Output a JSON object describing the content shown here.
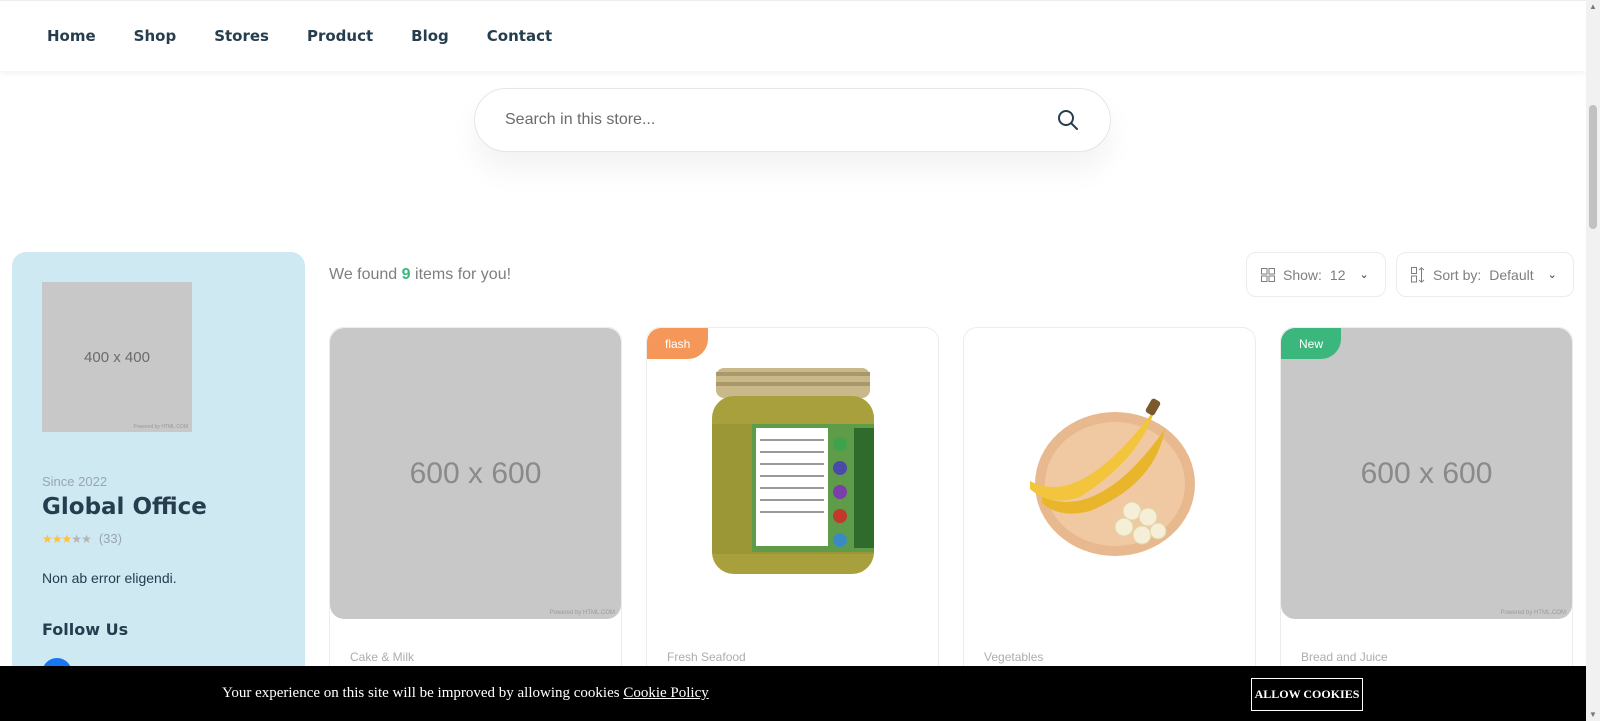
{
  "nav": {
    "items": [
      "Home",
      "Shop",
      "Stores",
      "Product",
      "Blog",
      "Contact"
    ]
  },
  "search": {
    "placeholder": "Search in this store...",
    "icon": "search-icon"
  },
  "sidebar": {
    "logo_text": "400 x 400",
    "logo_credit": "Powered by HTML.COM",
    "since": "Since 2022",
    "name": "Global Office",
    "rating": 3,
    "rating_max": 5,
    "rating_count": "(33)",
    "description": "Non ab error eligendi.",
    "follow_title": "Follow Us",
    "social_icon": "facebook-icon"
  },
  "results": {
    "prefix": "We found",
    "count": "9",
    "suffix": "items for you!"
  },
  "controls": {
    "show_label": "Show:",
    "show_value": "12",
    "sort_label": "Sort by:",
    "sort_value": "Default"
  },
  "products": [
    {
      "category": "Cake & Milk",
      "placeholder": "600 x 600",
      "credit": "Powered by HTML.COM",
      "badge": ""
    },
    {
      "category": "Fresh Seafood",
      "image": "jar-product-image",
      "badge": "flash"
    },
    {
      "category": "Vegetables",
      "image": "banana-product-image",
      "badge": ""
    },
    {
      "category": "Bread and Juice",
      "placeholder": "600 x 600",
      "credit": "Powered by HTML.COM",
      "badge": "New"
    }
  ],
  "cookie": {
    "message": "Your experience on this site will be improved by allowing cookies",
    "link": "Cookie Policy",
    "button": "ALLOW COOKIES"
  },
  "colors": {
    "brand": "#3bb77e",
    "flash": "#f59758",
    "sidebar_bg": "#cfe9f2",
    "heading": "#253d4e"
  }
}
